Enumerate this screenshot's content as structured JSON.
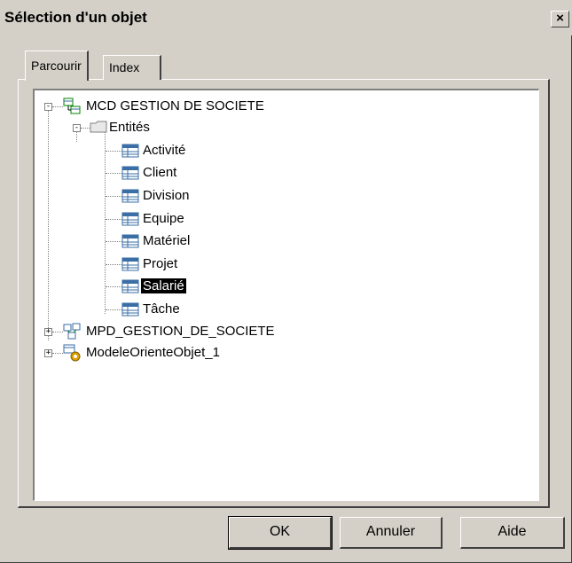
{
  "window": {
    "title": "Sélection d'un objet",
    "close_label": "×"
  },
  "tabs": [
    {
      "label": "Parcourir",
      "active": true
    },
    {
      "label": "Index",
      "active": false
    }
  ],
  "tree": {
    "root1": {
      "label": "MCD GESTION DE SOCIETE",
      "expanded": true
    },
    "folder": {
      "label": "Entités",
      "expanded": true
    },
    "entities": [
      "Activité",
      "Client",
      "Division",
      "Equipe",
      "Matériel",
      "Projet",
      "Salarié",
      "Tâche"
    ],
    "selected": "Salarié",
    "root2": {
      "label": "MPD_GESTION_DE_SOCIETE",
      "expanded": false
    },
    "root3": {
      "label": "ModeleOrienteObjet_1",
      "expanded": false
    },
    "expander_minus": "-",
    "expander_plus": "+"
  },
  "buttons": {
    "ok": "OK",
    "cancel": "Annuler",
    "help": "Aide"
  },
  "colors": {
    "dialog": "#d4d0c8",
    "selection": "#000000",
    "table_icon_border": "#3a6ea5"
  }
}
